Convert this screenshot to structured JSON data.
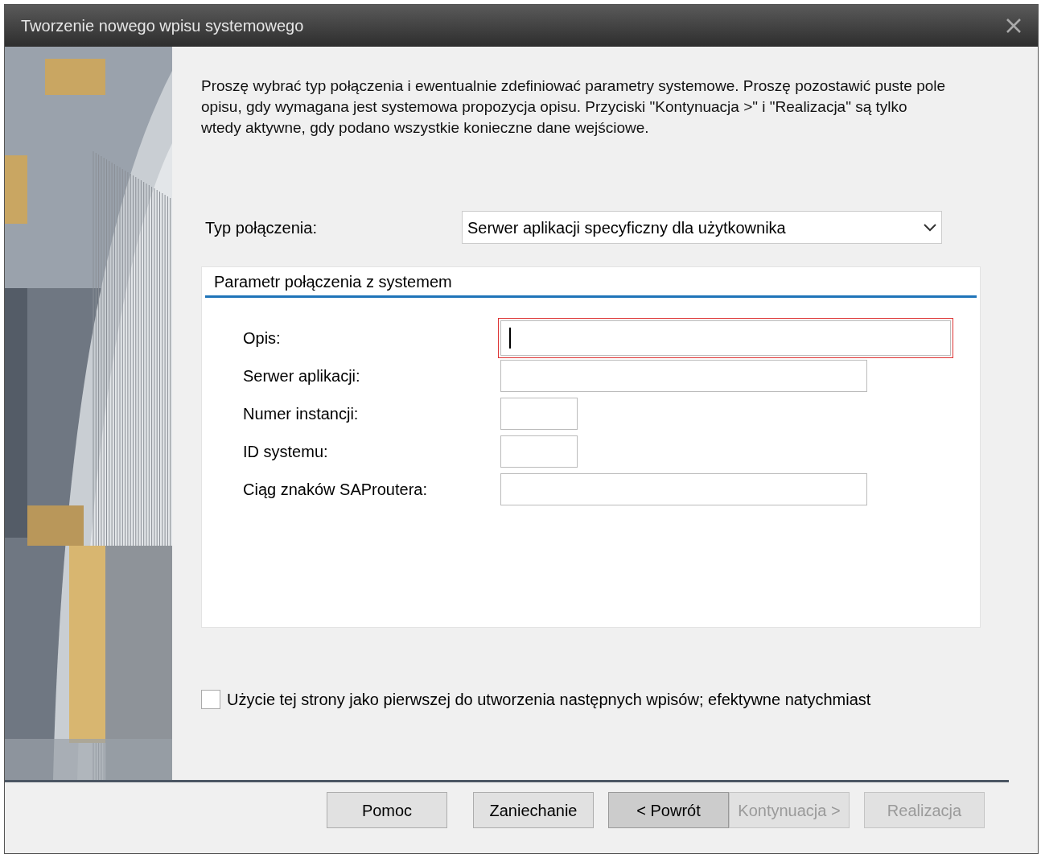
{
  "window": {
    "title": "Tworzenie nowego wpisu systemowego"
  },
  "intro": "Proszę wybrać typ połączenia i ewentualnie zdefiniować parametry systemowe. Proszę pozostawić puste pole opisu, gdy wymagana jest systemowa propozycja opisu. Przyciski \"Kontynuacja >\" i \"Realizacja\" są tylko wtedy aktywne, gdy podano wszystkie konieczne dane wejściowe.",
  "connection_type": {
    "label": "Typ połączenia:",
    "value": "Serwer aplikacji specyficzny dla użytkownika"
  },
  "group": {
    "title": "Parametr połączenia z systemem",
    "fields": [
      {
        "label": "Opis:",
        "kind": "long",
        "focused": true
      },
      {
        "label": "Serwer aplikacji:",
        "kind": "medium",
        "focused": false
      },
      {
        "label": "Numer instancji:",
        "kind": "short",
        "focused": false
      },
      {
        "label": "ID systemu:",
        "kind": "short",
        "focused": false
      },
      {
        "label": "Ciąg znaków SAProutera:",
        "kind": "medium",
        "focused": false
      }
    ]
  },
  "checkbox": {
    "label": "Użycie tej strony jako pierwszej do utworzenia następnych wpisów; efektywne natychmiast",
    "checked": false
  },
  "buttons": [
    {
      "label": "Pomoc",
      "disabled": false,
      "default": false
    },
    {
      "label": "Zaniechanie",
      "disabled": false,
      "default": false
    },
    {
      "label": "< Powrót",
      "disabled": false,
      "default": true
    },
    {
      "label": "Kontynuacja >",
      "disabled": true,
      "default": false
    },
    {
      "label": "Realizacja",
      "disabled": true,
      "default": false
    }
  ]
}
